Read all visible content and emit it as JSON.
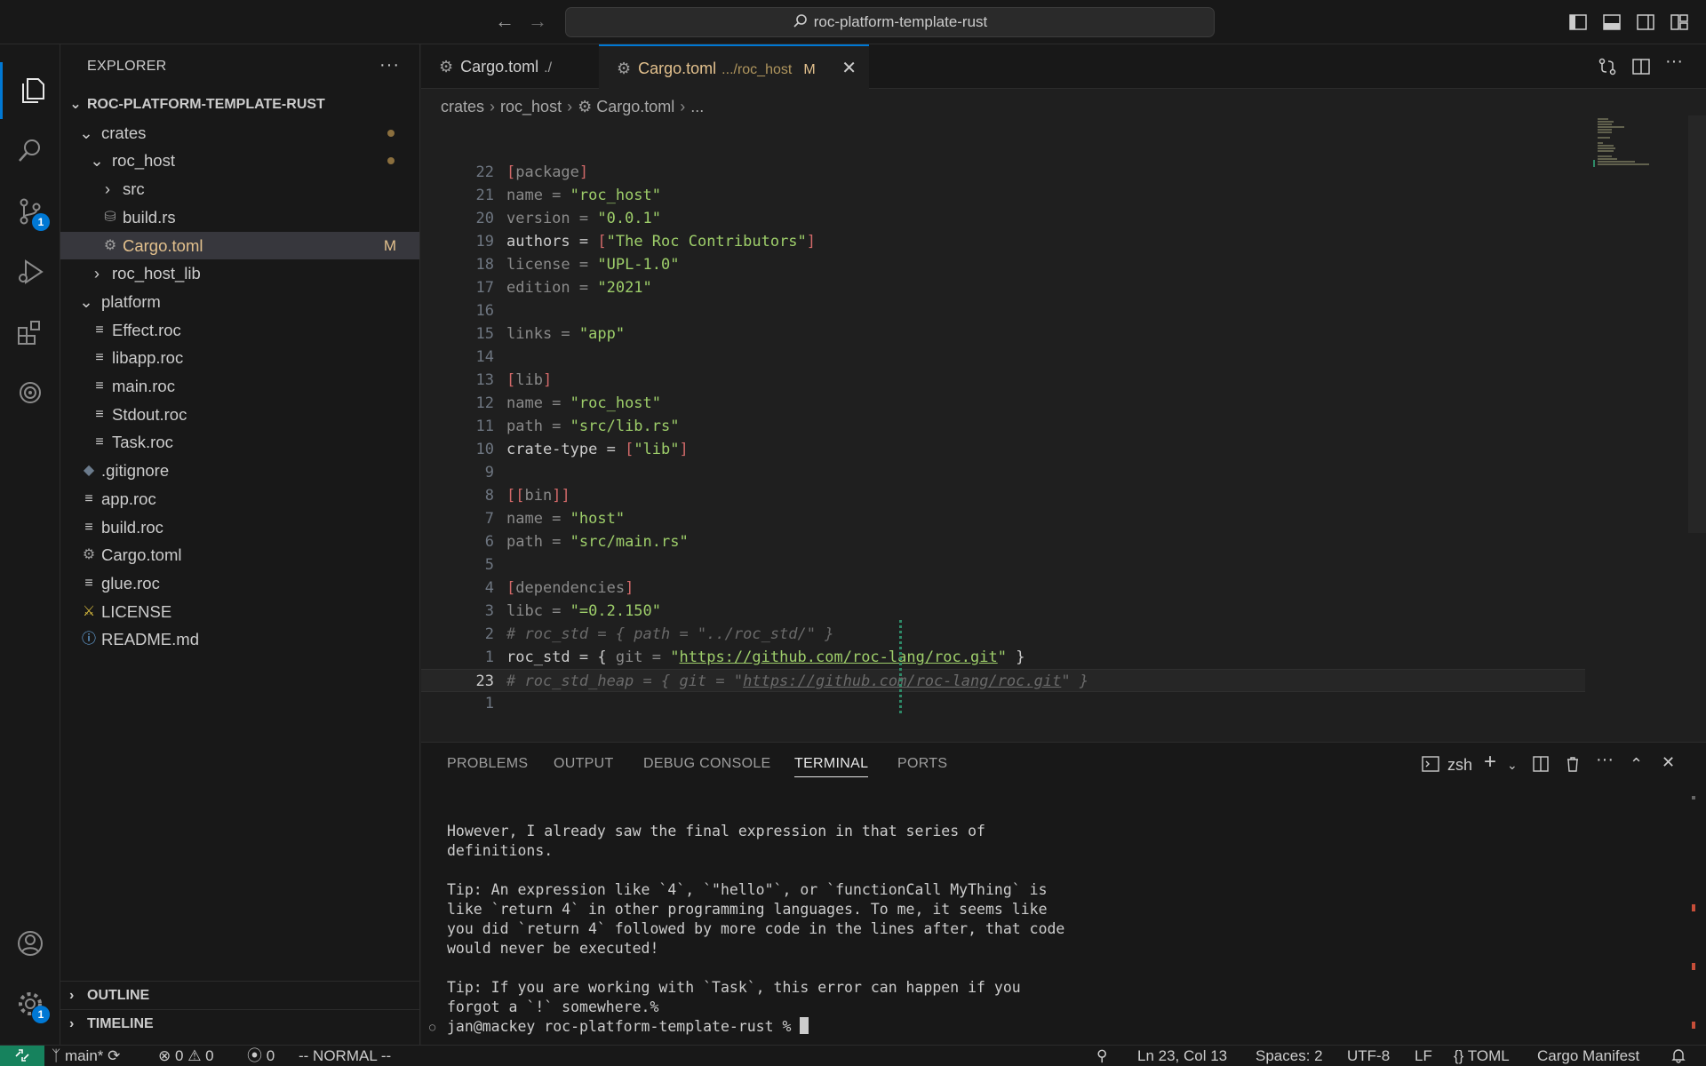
{
  "titlebar": {
    "search_text": "roc-platform-template-rust"
  },
  "activity": {
    "scm_badge": "1",
    "settings_badge": "1"
  },
  "sidebar": {
    "header": "EXPLORER",
    "root": "ROC-PLATFORM-TEMPLATE-RUST",
    "tree": [
      {
        "label": "crates",
        "kind": "folder-open",
        "indent": 0,
        "modified": "dot"
      },
      {
        "label": "roc_host",
        "kind": "folder-open",
        "indent": 1,
        "modified": "dot"
      },
      {
        "label": "src",
        "kind": "folder-closed",
        "indent": 2
      },
      {
        "label": "build.rs",
        "kind": "rust",
        "indent": 2
      },
      {
        "label": "Cargo.toml",
        "kind": "gear",
        "indent": 2,
        "modified": "M",
        "selected": true
      },
      {
        "label": "roc_host_lib",
        "kind": "folder-closed",
        "indent": 1
      },
      {
        "label": "platform",
        "kind": "folder-open",
        "indent": 0
      },
      {
        "label": "Effect.roc",
        "kind": "lines",
        "indent": 1
      },
      {
        "label": "libapp.roc",
        "kind": "lines",
        "indent": 1
      },
      {
        "label": "main.roc",
        "kind": "lines",
        "indent": 1
      },
      {
        "label": "Stdout.roc",
        "kind": "lines",
        "indent": 1
      },
      {
        "label": "Task.roc",
        "kind": "lines",
        "indent": 1
      },
      {
        "label": ".gitignore",
        "kind": "git",
        "indent": 0
      },
      {
        "label": "app.roc",
        "kind": "lines",
        "indent": 0
      },
      {
        "label": "build.roc",
        "kind": "lines",
        "indent": 0
      },
      {
        "label": "Cargo.toml",
        "kind": "gear",
        "indent": 0
      },
      {
        "label": "glue.roc",
        "kind": "lines",
        "indent": 0
      },
      {
        "label": "LICENSE",
        "kind": "license",
        "indent": 0
      },
      {
        "label": "README.md",
        "kind": "info",
        "indent": 0
      }
    ],
    "outline": "OUTLINE",
    "timeline": "TIMELINE"
  },
  "tabs": [
    {
      "name": "Cargo.toml",
      "desc": "./",
      "active": false
    },
    {
      "name": "Cargo.toml",
      "desc": ".../roc_host",
      "flag": "M",
      "active": true
    }
  ],
  "breadcrumb": [
    "crates",
    "roc_host",
    "Cargo.toml",
    "..."
  ],
  "code": [
    {
      "ln": "22",
      "tokens": [
        [
          "b",
          "["
        ],
        [
          "h",
          "package"
        ],
        [
          "b",
          "]"
        ]
      ]
    },
    {
      "ln": "21",
      "tokens": [
        [
          "h",
          "name = "
        ],
        [
          "s",
          "\"roc_host\""
        ]
      ]
    },
    {
      "ln": "20",
      "tokens": [
        [
          "h",
          "version = "
        ],
        [
          "s",
          "\"0.0.1\""
        ]
      ]
    },
    {
      "ln": "19",
      "tokens": [
        [
          "e",
          "authors = "
        ],
        [
          "b",
          "["
        ],
        [
          "s",
          "\"The Roc Contributors\""
        ],
        [
          "b",
          "]"
        ]
      ]
    },
    {
      "ln": "18",
      "tokens": [
        [
          "h",
          "license = "
        ],
        [
          "s",
          "\"UPL-1.0\""
        ]
      ]
    },
    {
      "ln": "17",
      "tokens": [
        [
          "h",
          "edition = "
        ],
        [
          "s",
          "\"2021\""
        ]
      ]
    },
    {
      "ln": "16",
      "tokens": []
    },
    {
      "ln": "15",
      "tokens": [
        [
          "h",
          "links = "
        ],
        [
          "s",
          "\"app\""
        ]
      ]
    },
    {
      "ln": "14",
      "tokens": []
    },
    {
      "ln": "13",
      "tokens": [
        [
          "b",
          "["
        ],
        [
          "h",
          "lib"
        ],
        [
          "b",
          "]"
        ]
      ]
    },
    {
      "ln": "12",
      "tokens": [
        [
          "h",
          "name = "
        ],
        [
          "s",
          "\"roc_host\""
        ]
      ]
    },
    {
      "ln": "11",
      "tokens": [
        [
          "h",
          "path = "
        ],
        [
          "s",
          "\"src/lib.rs\""
        ]
      ]
    },
    {
      "ln": "10",
      "tokens": [
        [
          "e",
          "crate-type = "
        ],
        [
          "b",
          "["
        ],
        [
          "s",
          "\"lib\""
        ],
        [
          "b",
          "]"
        ]
      ]
    },
    {
      "ln": "9",
      "tokens": []
    },
    {
      "ln": "8",
      "tokens": [
        [
          "b",
          "[["
        ],
        [
          "h",
          "bin"
        ],
        [
          "b",
          "]]"
        ]
      ]
    },
    {
      "ln": "7",
      "tokens": [
        [
          "h",
          "name = "
        ],
        [
          "s",
          "\"host\""
        ]
      ]
    },
    {
      "ln": "6",
      "tokens": [
        [
          "h",
          "path = "
        ],
        [
          "s",
          "\"src/main.rs\""
        ]
      ]
    },
    {
      "ln": "5",
      "tokens": []
    },
    {
      "ln": "4",
      "tokens": [
        [
          "b",
          "["
        ],
        [
          "h",
          "dependencies"
        ],
        [
          "b",
          "]"
        ]
      ]
    },
    {
      "ln": "3",
      "tokens": [
        [
          "h",
          "libc = "
        ],
        [
          "s",
          "\"=0.2.150\""
        ]
      ]
    },
    {
      "ln": "2",
      "tokens": [
        [
          "cm",
          "# roc_std = { path = \"../roc_std/\" }"
        ]
      ]
    },
    {
      "ln": "1",
      "tokens": [
        [
          "e",
          "roc_std = { "
        ],
        [
          "h",
          "git = "
        ],
        [
          "s",
          "\""
        ],
        [
          "url",
          "https://github.com/roc-lang/roc.git"
        ],
        [
          "s",
          "\""
        ],
        [
          "e",
          " }"
        ]
      ]
    },
    {
      "ln": "23",
      "tokens": [
        [
          "cm",
          "# roc_std_heap = { git = \""
        ],
        [
          "cmurl",
          "https://github.com/roc-lang/roc.git"
        ],
        [
          "cm",
          "\" }"
        ]
      ],
      "current": true
    },
    {
      "ln": "1",
      "tokens": []
    }
  ],
  "panel": {
    "tabs": [
      "PROBLEMS",
      "OUTPUT",
      "DEBUG CONSOLE",
      "TERMINAL",
      "PORTS"
    ],
    "active_tab": "TERMINAL",
    "shell": "zsh",
    "terminal_lines": [
      "However, I already saw the final expression in that series of",
      "definitions.",
      "",
      "Tip: An expression like `4`, `\"hello\"`, or `functionCall MyThing` is",
      "like `return 4` in other programming languages. To me, it seems like",
      "you did `return 4` followed by more code in the lines after, that code",
      "would never be executed!",
      "",
      "Tip: If you are working with `Task`, this error can happen if you",
      "forgot a `!` somewhere.%"
    ],
    "prompt": "jan@mackey roc-platform-template-rust % "
  },
  "status": {
    "branch": "main*",
    "errors": "0",
    "warnings": "0",
    "ports": "0",
    "mode": "-- NORMAL --",
    "position": "Ln 23, Col 13",
    "spaces": "Spaces: 2",
    "encoding": "UTF-8",
    "eol": "LF",
    "language": "TOML",
    "extra": "Cargo Manifest"
  },
  "colors": {
    "accent": "#0078d4",
    "modified": "#e2c08d",
    "string": "#9ece6a",
    "bracket": "#d16969"
  }
}
